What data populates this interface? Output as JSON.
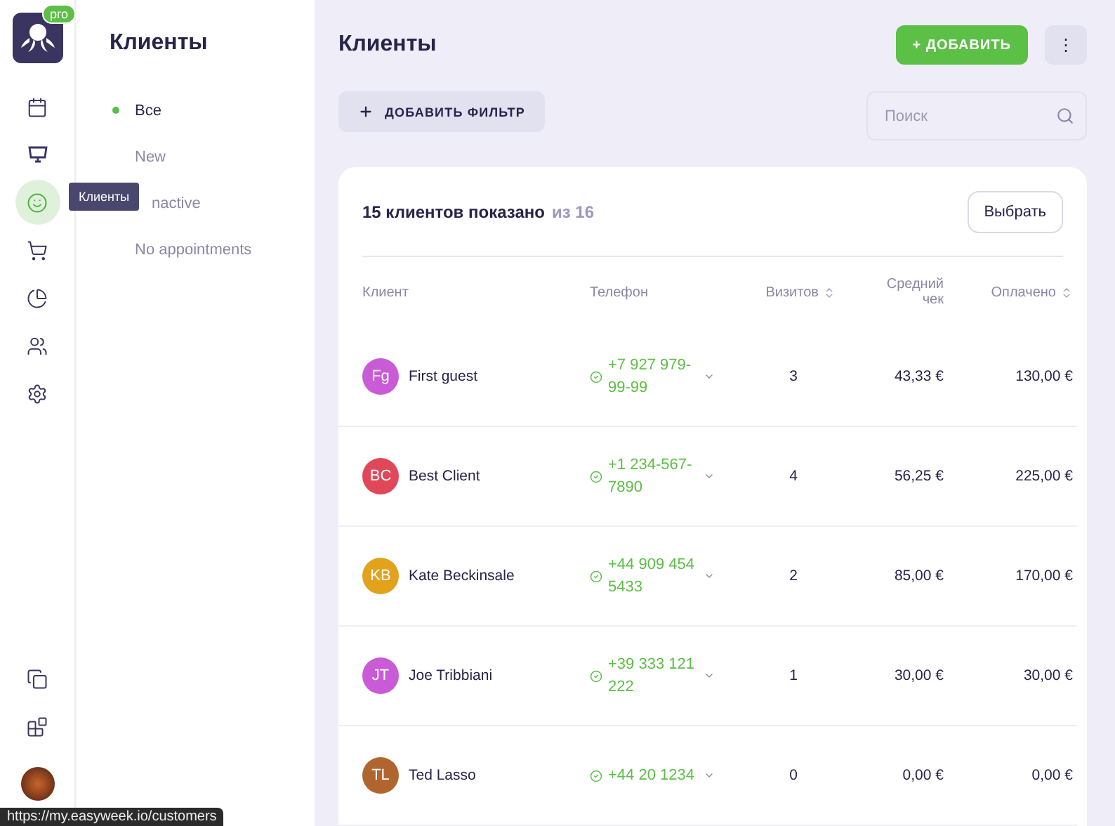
{
  "rail": {
    "badge": "pro",
    "items": [
      {
        "kind": "calendar",
        "selected": false
      },
      {
        "kind": "monitor",
        "selected": false
      },
      {
        "kind": "smile",
        "selected": true
      },
      {
        "kind": "cart",
        "selected": false
      },
      {
        "kind": "chart",
        "selected": false
      },
      {
        "kind": "users",
        "selected": false
      },
      {
        "kind": "settings",
        "selected": false
      }
    ],
    "bottom_items": [
      {
        "kind": "copy"
      },
      {
        "kind": "blocks"
      }
    ]
  },
  "tooltip": "Клиенты",
  "submenu": {
    "title": "Клиенты",
    "items": [
      {
        "label": "Все",
        "selected": true
      },
      {
        "label": "New",
        "selected": false
      },
      {
        "label": "nactive",
        "selected": false,
        "kind": "covered"
      },
      {
        "label": "No appointments",
        "selected": false
      }
    ]
  },
  "header": {
    "title": "Клиенты",
    "add_button": "+ ДОБАВИТЬ",
    "more_button": "⋮"
  },
  "filter_button": "ДОБАВИТЬ ФИЛЬТР",
  "search": {
    "placeholder": "Поиск"
  },
  "card": {
    "summary": "15 клиентов показано",
    "summary_total": "из 16",
    "select_button": "Выбрать"
  },
  "table": {
    "columns": [
      {
        "label": "Клиент",
        "sortable": false
      },
      {
        "label": "Телефон",
        "sortable": false
      },
      {
        "label": "Визитов",
        "sortable": true
      },
      {
        "label": "Средний чек",
        "sortable": false
      },
      {
        "label": "Оплачено",
        "sortable": true
      }
    ],
    "rows": [
      {
        "initials": "Fg",
        "color": "#c95bd6",
        "name": "First guest",
        "phone": "+7 927 979-99-99",
        "visits": "3",
        "average": "43,33 €",
        "paid": "130,00 €"
      },
      {
        "initials": "BC",
        "color": "#e0485a",
        "name": "Best Client",
        "phone": "+1 234-567-7890",
        "visits": "4",
        "average": "56,25 €",
        "paid": "225,00 €"
      },
      {
        "initials": "KB",
        "color": "#e3a21c",
        "name": "Kate Beckinsale",
        "phone": "+44 909 454 5433",
        "visits": "2",
        "average": "85,00 €",
        "paid": "170,00 €"
      },
      {
        "initials": "JT",
        "color": "#c95bd6",
        "name": "Joe Tribbiani",
        "phone": "+39 333 121 222",
        "visits": "1",
        "average": "30,00 €",
        "paid": "30,00 €"
      },
      {
        "initials": "TL",
        "color": "#b0652e",
        "name": "Ted Lasso",
        "phone": "+44 20 1234",
        "visits": "0",
        "average": "0,00 €",
        "paid": "0,00 €"
      }
    ]
  },
  "status_url": "https://my.easyweek.io/customers"
}
